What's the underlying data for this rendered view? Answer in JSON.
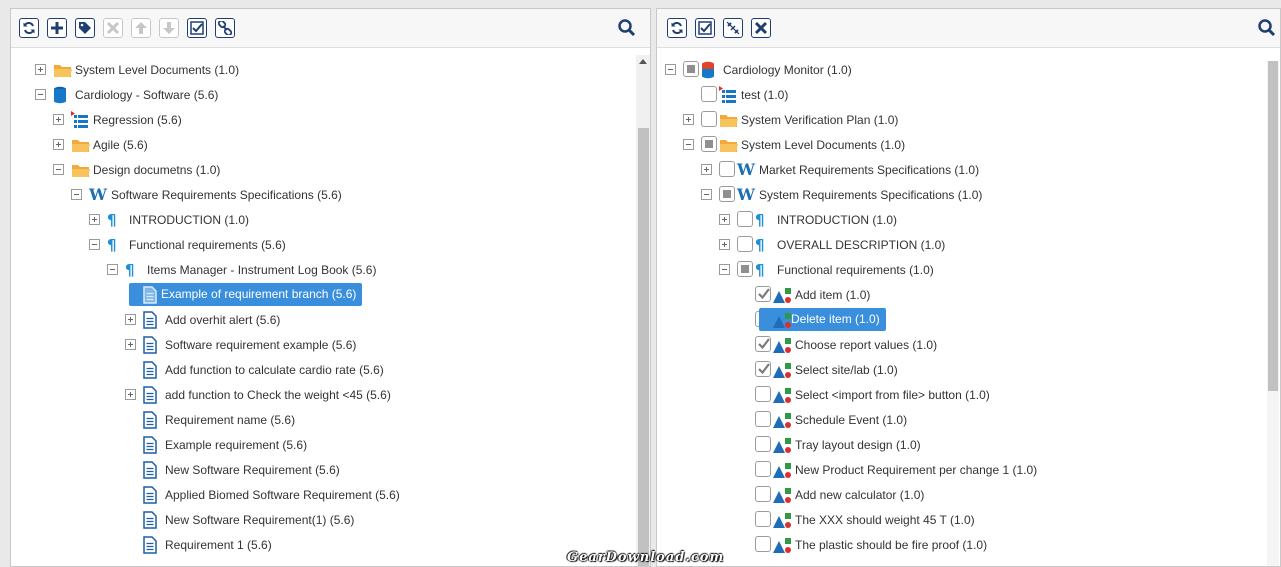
{
  "left": {
    "tree": [
      {
        "label": "System Level Documents (1.0)",
        "icon": "folder-icon",
        "exp": "plus",
        "level": 0
      },
      {
        "label": "Cardiology - Software (5.6)",
        "icon": "database-icon",
        "exp": "minus",
        "level": 0
      },
      {
        "label": "Regression (5.6)",
        "icon": "list-icon",
        "exp": "plus",
        "level": 1
      },
      {
        "label": "Agile (5.6)",
        "icon": "folder-icon",
        "exp": "plus",
        "level": 1
      },
      {
        "label": "Design documetns (1.0)",
        "icon": "folder-icon",
        "exp": "minus",
        "level": 1
      },
      {
        "label": "Software Requirements Specifications (5.6)",
        "icon": "word-icon",
        "exp": "minus",
        "level": 2
      },
      {
        "label": "INTRODUCTION (1.0)",
        "icon": "paragraph-icon",
        "exp": "plus",
        "level": 3
      },
      {
        "label": "Functional requirements (5.6)",
        "icon": "paragraph-icon",
        "exp": "minus",
        "level": 3
      },
      {
        "label": "Items Manager - Instrument Log Book (5.6)",
        "icon": "paragraph-icon",
        "exp": "minus",
        "level": 4
      },
      {
        "label": "Example of requirement branch (5.6)",
        "icon": "document-icon",
        "exp": "",
        "level": 5,
        "selected": true
      },
      {
        "label": "Add overhit alert (5.6)",
        "icon": "document-icon",
        "exp": "plus",
        "level": 5
      },
      {
        "label": "Software requirement example (5.6)",
        "icon": "document-icon",
        "exp": "plus",
        "level": 5
      },
      {
        "label": "Add function to calculate cardio rate (5.6)",
        "icon": "document-icon",
        "exp": "",
        "level": 5
      },
      {
        "label": "add function to Check the weight <45 (5.6)",
        "icon": "document-icon",
        "exp": "plus",
        "level": 5
      },
      {
        "label": "Requirement name (5.6)",
        "icon": "document-icon",
        "exp": "",
        "level": 5
      },
      {
        "label": "Example requirement (5.6)",
        "icon": "document-icon",
        "exp": "",
        "level": 5
      },
      {
        "label": "New Software Requirement (5.6)",
        "icon": "document-icon",
        "exp": "",
        "level": 5
      },
      {
        "label": "Applied Biomed Software Requirement (5.6)",
        "icon": "document-icon",
        "exp": "",
        "level": 5
      },
      {
        "label": "New Software Requirement(1) (5.6)",
        "icon": "document-icon",
        "exp": "",
        "level": 5
      },
      {
        "label": "Requirement 1 (5.6)",
        "icon": "document-icon",
        "exp": "",
        "level": 5
      }
    ]
  },
  "right": {
    "tree": [
      {
        "label": "Cardiology Monitor (1.0)",
        "icon": "database-icon",
        "exp": "minus",
        "level": 0,
        "check": "partial"
      },
      {
        "label": "test (1.0)",
        "icon": "list-icon",
        "exp": "",
        "level": 1,
        "check": "none"
      },
      {
        "label": "System Verification Plan (1.0)",
        "icon": "folder-icon",
        "exp": "plus",
        "level": 1,
        "check": "none"
      },
      {
        "label": "System Level Documents (1.0)",
        "icon": "folder-icon",
        "exp": "minus",
        "level": 1,
        "check": "partial"
      },
      {
        "label": "Market Requirements Specifications (1.0)",
        "icon": "word-icon",
        "exp": "plus",
        "level": 2,
        "check": "none"
      },
      {
        "label": "System Requirements Specifications (1.0)",
        "icon": "word-icon",
        "exp": "minus",
        "level": 2,
        "check": "partial"
      },
      {
        "label": "INTRODUCTION (1.0)",
        "icon": "paragraph-icon",
        "exp": "plus",
        "level": 3,
        "check": "none"
      },
      {
        "label": "OVERALL DESCRIPTION (1.0)",
        "icon": "paragraph-icon",
        "exp": "plus",
        "level": 3,
        "check": "none"
      },
      {
        "label": "Functional requirements (1.0)",
        "icon": "paragraph-icon",
        "exp": "minus",
        "level": 3,
        "check": "partial"
      },
      {
        "label": "Add item (1.0)",
        "icon": "shapes-icon",
        "exp": "",
        "level": 4,
        "check": "checked"
      },
      {
        "label": "Delete item (1.0)",
        "icon": "shapes-icon",
        "exp": "",
        "level": 4,
        "check": "none",
        "selected": true
      },
      {
        "label": "Choose report values (1.0)",
        "icon": "shapes-icon",
        "exp": "",
        "level": 4,
        "check": "checked"
      },
      {
        "label": "Select site/lab (1.0)",
        "icon": "shapes-icon",
        "exp": "",
        "level": 4,
        "check": "checked"
      },
      {
        "label": "Select <import from file> button (1.0)",
        "icon": "shapes-icon",
        "exp": "",
        "level": 4,
        "check": "none"
      },
      {
        "label": "Schedule Event (1.0)",
        "icon": "shapes-icon",
        "exp": "",
        "level": 4,
        "check": "none"
      },
      {
        "label": "Tray layout design (1.0)",
        "icon": "shapes-icon",
        "exp": "",
        "level": 4,
        "check": "none"
      },
      {
        "label": "New Product Requirement per change 1 (1.0)",
        "icon": "shapes-icon",
        "exp": "",
        "level": 4,
        "check": "none"
      },
      {
        "label": "Add new calculator (1.0)",
        "icon": "shapes-icon",
        "exp": "",
        "level": 4,
        "check": "none"
      },
      {
        "label": "The XXX should weight 45 T (1.0)",
        "icon": "shapes-icon",
        "exp": "",
        "level": 4,
        "check": "none"
      },
      {
        "label": "The plastic should be fire proof (1.0)",
        "icon": "shapes-icon",
        "exp": "",
        "level": 4,
        "check": "none"
      }
    ]
  },
  "watermark": "GearDownload.com"
}
